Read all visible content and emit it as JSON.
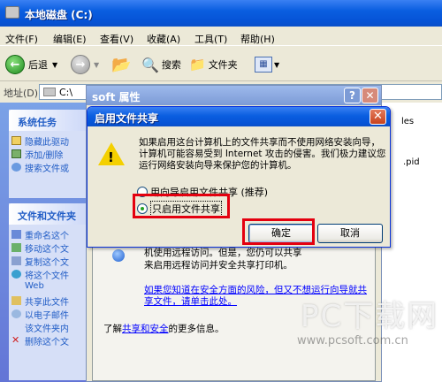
{
  "explorer": {
    "title": "本地磁盘 (C:)",
    "menu": [
      "文件(F)",
      "编辑(E)",
      "查看(V)",
      "收藏(A)",
      "工具(T)",
      "帮助(H)"
    ],
    "toolbar": {
      "back": "后退",
      "search": "搜索",
      "folders": "文件夹"
    },
    "address_label": "地址(D)",
    "address_value": "C:\\",
    "tasks_panel": {
      "header": "系统任务",
      "items": [
        "隐藏此驱动",
        "添加/删除",
        "搜索文件或"
      ]
    },
    "file_panel": {
      "header": "文件和文件夹",
      "items": [
        "重命名这个",
        "移动这个文",
        "复制这个文",
        "将这个文件",
        "Web",
        "共享此文件",
        "以电子邮件",
        "该文件夹内",
        "删除这个文"
      ]
    },
    "file_fragments": [
      "les",
      ".pid"
    ]
  },
  "props_window": {
    "title": "soft 属性",
    "help_btn": "?",
    "close_btn": "✕",
    "lines": [
      "机使用远程访问。但是，您仍可以共享",
      "来启用远程访问并安全共享打印机。"
    ],
    "link_text": "如果您知道在安全方面的风险，但又不想运行向导就共享文件，请单击此处。",
    "footer_prefix": "了解",
    "footer_link": "共享和安全",
    "footer_suffix": "的更多信息。"
  },
  "dialog": {
    "title": "启用文件共享",
    "close_btn": "✕",
    "message": "如果启用这台计算机上的文件共享而不使用网络安装向导，计算机可能容易受到 Internet 攻击的侵害。我们极力建议您运行网络安装向导来保护您的计算机。",
    "option_wizard": "用向导启用文件共享 (推荐)",
    "option_only": "只启用文件共享",
    "ok": "确定",
    "cancel": "取消"
  },
  "watermark": {
    "brand": "PC下载网",
    "url": "www.pcsoft.com.cn"
  },
  "colors": {
    "highlight": "#e4000f",
    "xp_blue": "#0a5ee0"
  }
}
